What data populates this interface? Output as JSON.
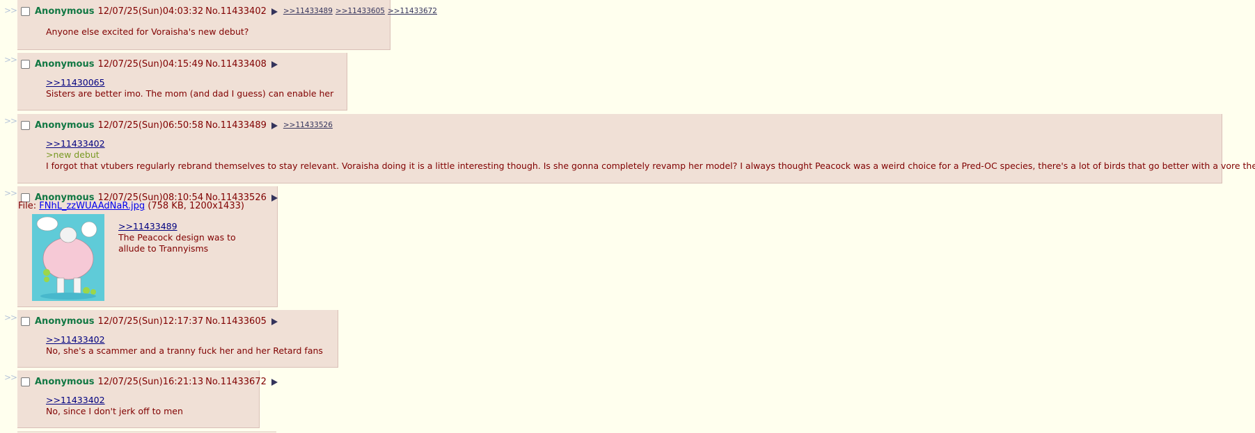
{
  "posts": [
    {
      "id": "p1",
      "name": "Anonymous",
      "datetime": "12/07/25(Sun)04:03:32",
      "number": "No.11433402",
      "backlinks": [
        ">>11433489",
        ">>11433605",
        ">>11433672"
      ],
      "quotes": [],
      "greentext": [],
      "lines": [
        "Anyone else excited for Voraisha's new debut?"
      ]
    },
    {
      "id": "p2",
      "name": "Anonymous",
      "datetime": "12/07/25(Sun)04:15:49",
      "number": "No.11433408",
      "backlinks": [],
      "quotes": [
        ">>11430065"
      ],
      "lines": [
        "Sisters are better imo. The mom (and dad I guess) can enable her"
      ]
    },
    {
      "id": "p3",
      "name": "Anonymous",
      "datetime": "12/07/25(Sun)06:50:58",
      "number": "No.11433489",
      "backlinks": [
        ">>11433526"
      ],
      "quotes": [
        ">>11433402"
      ],
      "greentext": [
        ">new debut"
      ],
      "lines": [
        "I forgot that vtubers regularly rebrand themselves to stay relevant. Voraisha doing it is a little interesting though. Is she gonna completely revamp her model? I always thought Peacock was a weird choice for a Pred-OC species, there's a lot of birds that go better with a vore theme."
      ]
    },
    {
      "id": "p4",
      "name": "Anonymous",
      "datetime": "12/07/25(Sun)08:10:54",
      "number": "No.11433526",
      "file_label": "File: ",
      "file_name": "FNhL_zzWUAAdNaR.jpg",
      "file_info": " (758 KB, 1200x1433)",
      "quotes": [
        ">>11433489"
      ],
      "lines": [
        "The Peacock design was to",
        "allude to Trannyisms"
      ]
    },
    {
      "id": "p5",
      "name": "Anonymous",
      "datetime": "12/07/25(Sun)12:17:37",
      "number": "No.11433605",
      "quotes": [
        ">>11433402"
      ],
      "lines": [
        "No, she's a scammer and a tranny fuck her and her Retard fans"
      ]
    },
    {
      "id": "p6",
      "name": "Anonymous",
      "datetime": "12/07/25(Sun)16:21:13",
      "number": "No.11433672",
      "quotes": [
        ">>11433402"
      ],
      "lines": [
        "No, since I don't jerk off to men"
      ]
    }
  ],
  "side_marker": ">>",
  "colors": {
    "background": "#ffffee",
    "reply_bg": "#f0e0d6",
    "name": "#117743",
    "text": "#800000",
    "greentext": "#789922",
    "quotelink": "#000080",
    "backlink": "#34345c"
  },
  "icons": {
    "menu": "triangle-right-icon",
    "checkbox": "checkbox-icon"
  }
}
